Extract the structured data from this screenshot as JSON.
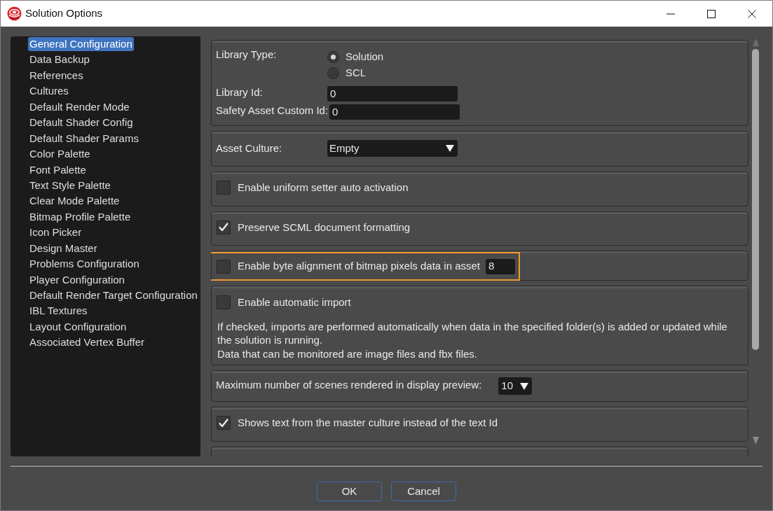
{
  "window": {
    "title": "Solution Options"
  },
  "sidebar": {
    "items": [
      {
        "label": "General Configuration",
        "selected": true
      },
      {
        "label": "Data Backup",
        "selected": false
      },
      {
        "label": "References",
        "selected": false
      },
      {
        "label": "Cultures",
        "selected": false
      },
      {
        "label": "Default Render Mode",
        "selected": false
      },
      {
        "label": "Default Shader Config",
        "selected": false
      },
      {
        "label": "Default Shader Params",
        "selected": false
      },
      {
        "label": "Color Palette",
        "selected": false
      },
      {
        "label": "Font Palette",
        "selected": false
      },
      {
        "label": "Text Style Palette",
        "selected": false
      },
      {
        "label": "Clear Mode Palette",
        "selected": false
      },
      {
        "label": "Bitmap Profile Palette",
        "selected": false
      },
      {
        "label": "Icon Picker",
        "selected": false
      },
      {
        "label": "Design Master",
        "selected": false
      },
      {
        "label": "Problems Configuration",
        "selected": false
      },
      {
        "label": "Player Configuration",
        "selected": false
      },
      {
        "label": "Default Render Target Configuration",
        "selected": false
      },
      {
        "label": "IBL Textures",
        "selected": false
      },
      {
        "label": "Layout Configuration",
        "selected": false
      },
      {
        "label": "Associated Vertex Buffer",
        "selected": false
      }
    ]
  },
  "settings": [
    {
      "kind": "group",
      "type_label": "Library Type:",
      "options": [
        {
          "label": "Solution",
          "selected": true
        },
        {
          "label": "SCL",
          "selected": false
        }
      ],
      "fields": [
        {
          "label": "Library Id:",
          "value": "0"
        },
        {
          "label": "Safety Asset Custom Id:",
          "value": "0"
        }
      ]
    },
    {
      "kind": "combo",
      "label": "Asset Culture:",
      "value": "Empty"
    },
    {
      "kind": "checkbox",
      "label": "Enable uniform setter auto activation",
      "checked": false
    },
    {
      "kind": "checkbox",
      "label": "Preserve SCML document formatting",
      "checked": true
    },
    {
      "kind": "checkfield",
      "label": "Enable byte alignment of bitmap pixels data in asset",
      "checked": false,
      "value": "8",
      "highlighted": true
    },
    {
      "kind": "checknote",
      "label": "Enable automatic import",
      "checked": false,
      "note": [
        "If checked, imports are performed automatically when data in the specified folder(s) is added or updated while the solution is running.",
        "Data that can be monitored are image files and fbx files."
      ]
    },
    {
      "kind": "minicombo",
      "label": "Maximum number of scenes rendered in display preview:",
      "value": "10"
    },
    {
      "kind": "checkbox",
      "label": "Shows text from the master culture instead of the text Id",
      "checked": true
    }
  ],
  "buttons": [
    {
      "label": "OK"
    },
    {
      "label": "Cancel"
    }
  ]
}
